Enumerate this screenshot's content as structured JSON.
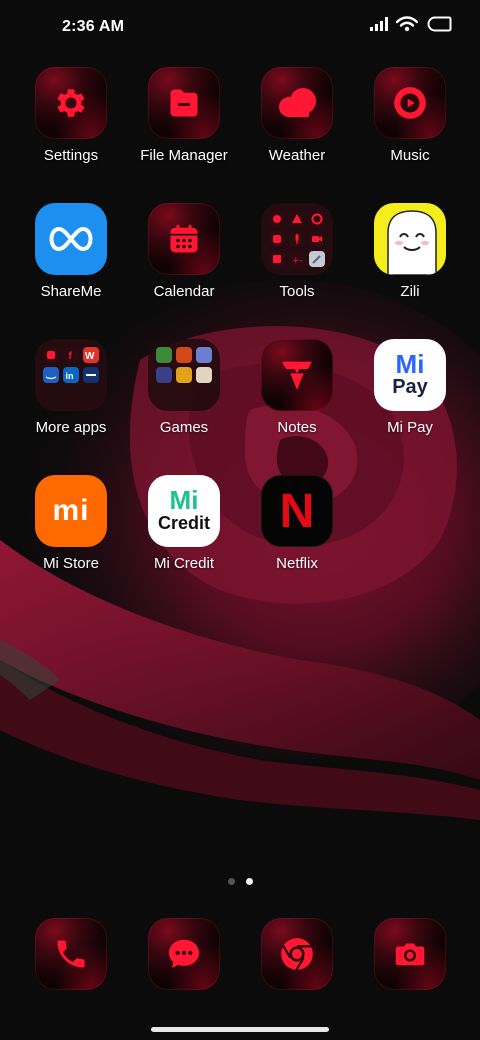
{
  "status_bar": {
    "time": "2:36 AM",
    "icons": [
      "signal-icon",
      "wifi-icon",
      "battery-icon"
    ]
  },
  "apps": [
    {
      "label": "Settings",
      "icon": "gear-icon"
    },
    {
      "label": "File Manager",
      "icon": "folder-icon"
    },
    {
      "label": "Weather",
      "icon": "cloud-icon"
    },
    {
      "label": "Music",
      "icon": "play-icon"
    },
    {
      "label": "ShareMe",
      "icon": "infinity-icon"
    },
    {
      "label": "Calendar",
      "icon": "calendar-icon"
    },
    {
      "label": "Tools",
      "icon": "tools-folder-icon"
    },
    {
      "label": "Zili",
      "icon": "zili-ghost-icon"
    },
    {
      "label": "More apps",
      "icon": "more-apps-folder-icon"
    },
    {
      "label": "Games",
      "icon": "games-folder-icon"
    },
    {
      "label": "Notes",
      "icon": "notes-icon"
    },
    {
      "label": "Mi Pay",
      "icon": "mipay-logo-icon",
      "logo_top": "Mi",
      "logo_bottom": "Pay"
    },
    {
      "label": "Mi Store",
      "icon": "mi-logo-icon",
      "logo_text": "mi"
    },
    {
      "label": "Mi Credit",
      "icon": "micredit-logo-icon",
      "logo_top": "Mi",
      "logo_bottom": "Credit"
    },
    {
      "label": "Netflix",
      "icon": "netflix-logo-icon",
      "logo_text": "N"
    }
  ],
  "folder_contents": {
    "more_apps": [
      "Facebook",
      "WPS",
      "Amazon",
      "LinkedIn",
      "Booking"
    ]
  },
  "dock": [
    {
      "name": "phone",
      "icon": "phone-icon"
    },
    {
      "name": "messaging",
      "icon": "message-icon"
    },
    {
      "name": "browser",
      "icon": "chrome-icon"
    },
    {
      "name": "camera",
      "icon": "camera-icon"
    }
  ],
  "pager": {
    "pages": 2,
    "current": 2
  },
  "colors": {
    "accent_red": "#e8112d",
    "mi_orange": "#ff6a00",
    "shareme_blue": "#1e90ff",
    "zili_yellow": "#f7ef1c",
    "mipay_blue": "#2a66ff",
    "micredit_green": "#1ec28b",
    "netflix_red": "#e50914"
  }
}
